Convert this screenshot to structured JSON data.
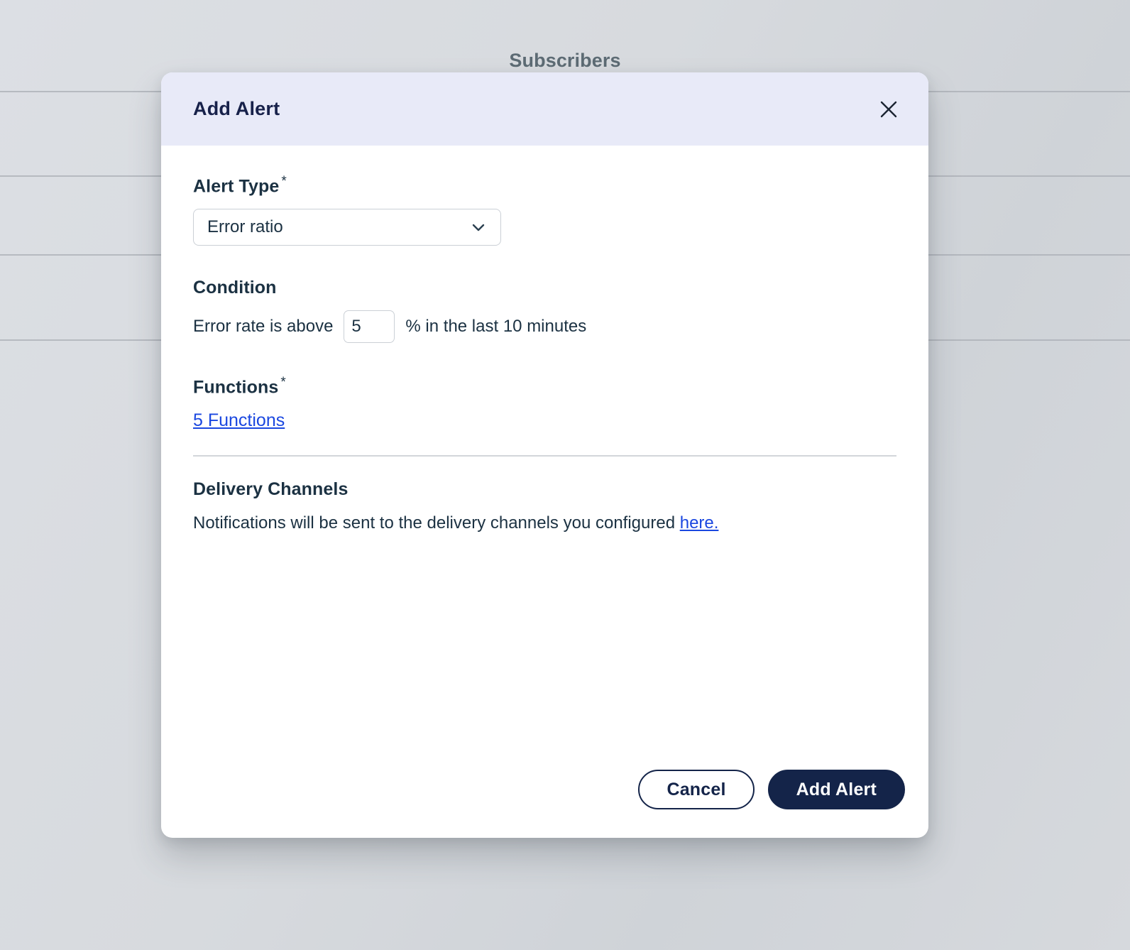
{
  "background": {
    "chart_title": "Subscribers",
    "gridline_positions": [
      128,
      247,
      358,
      478
    ]
  },
  "modal": {
    "title": "Add Alert",
    "close_icon": "close-icon",
    "alert_type": {
      "label": "Alert Type",
      "required_marker": "*",
      "selected_value": "Error ratio",
      "chevron_icon": "chevron-down-icon"
    },
    "condition": {
      "label": "Condition",
      "prefix_text": "Error rate is above",
      "threshold_value": "5",
      "suffix_text": "% in the last 10 minutes"
    },
    "functions": {
      "label": "Functions",
      "required_marker": "*",
      "link_text": "5 Functions"
    },
    "delivery_channels": {
      "label": "Delivery Channels",
      "note_text": "Notifications will be sent to the delivery channels you configured",
      "link_text": "here."
    },
    "footer": {
      "cancel_label": "Cancel",
      "submit_label": "Add Alert"
    }
  },
  "annotation": {
    "arrow_icon": "arrow-pointer-icon",
    "points_to": "here."
  },
  "colors": {
    "header_bg": "#e8eaf8",
    "title_navy": "#17214a",
    "text_navy": "#1b3142",
    "link_blue": "#1a47e0",
    "primary_button": "#142449",
    "backdrop": "#d7dade"
  }
}
